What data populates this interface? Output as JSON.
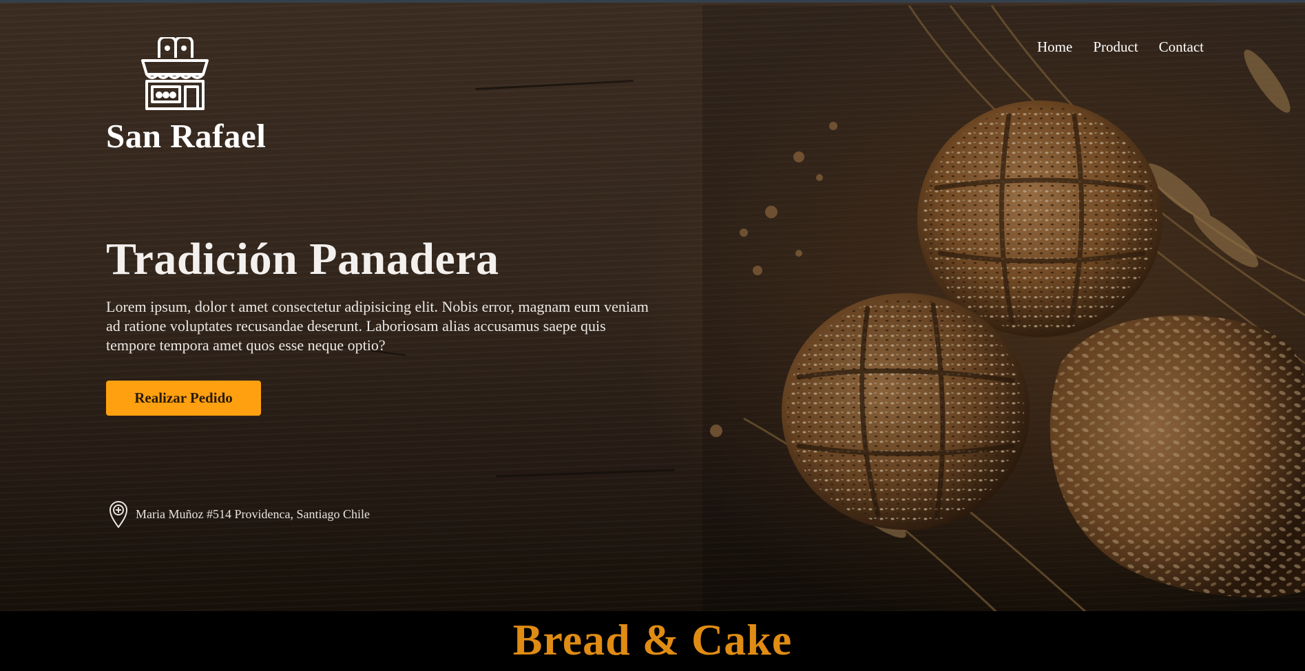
{
  "brand": {
    "name": "San Rafael",
    "logo_icon": "bakery-shop-icon"
  },
  "nav": {
    "items": [
      "Home",
      "Product",
      "Contact"
    ]
  },
  "hero": {
    "headline": "Tradición Panadera",
    "lead": "Lorem ipsum, dolor t amet consectetur adipisicing elit. Nobis error, magnam eum veniam ad ratione voluptates recusandae deserunt. Laboriosam alias accusamus saepe quis tempore tempora amet quos esse neque optio?",
    "cta_label": "Realizar Pedido",
    "address": "Maria Muñoz #514 Providenca, Santiago Chile",
    "address_icon": "location-pin-icon",
    "background_image": "bread-rolls-on-wooden-table"
  },
  "section": {
    "title": "Bread & Cake"
  },
  "colors": {
    "accent": "#ffa010",
    "section_title": "#e08c14",
    "text": "#ffffff",
    "band_background": "#000000"
  }
}
